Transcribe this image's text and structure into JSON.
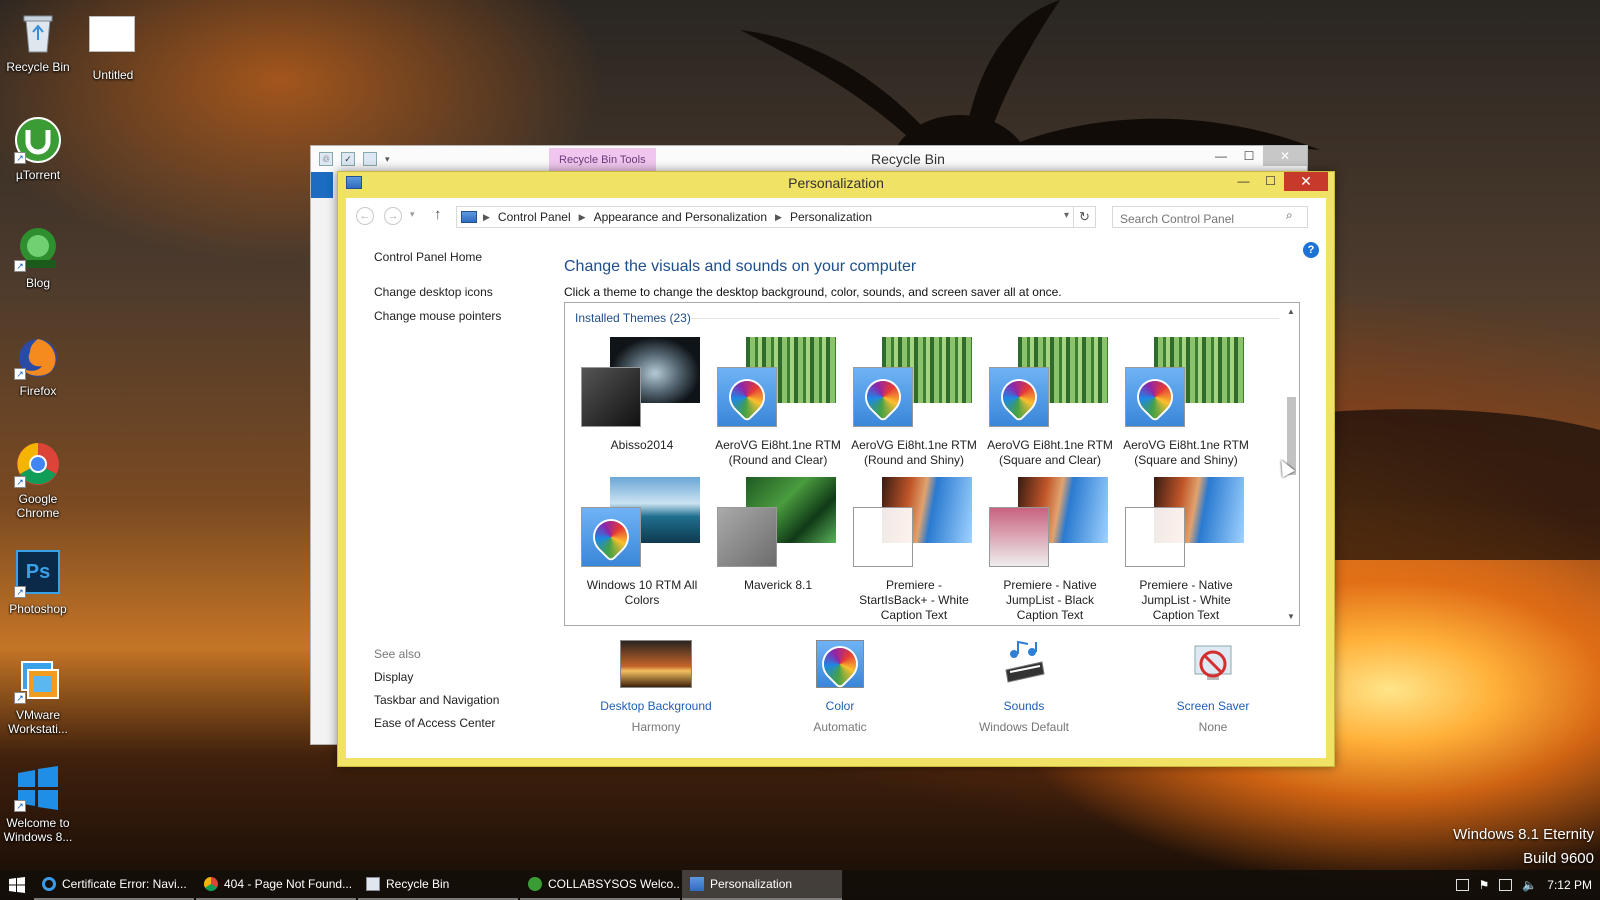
{
  "desktop": {
    "icons": [
      {
        "label": "Recycle Bin",
        "icon": "recycle-bin-icon"
      },
      {
        "label": "Untitled",
        "icon": "blank-file-icon"
      },
      {
        "label": "µTorrent",
        "icon": "utorrent-icon"
      },
      {
        "label": "Blog",
        "icon": "collabsysos-icon"
      },
      {
        "label": "Firefox",
        "icon": "firefox-icon"
      },
      {
        "label": "Google Chrome",
        "icon": "chrome-icon"
      },
      {
        "label": "Photoshop",
        "icon": "photoshop-icon"
      },
      {
        "label": "VMware Workstati...",
        "icon": "vmware-icon"
      },
      {
        "label": "Welcome to Windows 8...",
        "icon": "windows-icon"
      }
    ],
    "photoshop_badge": "Ps",
    "watermark": {
      "line1": "Windows 8.1 Eternity",
      "line2": "Build 9600"
    }
  },
  "recycle_window": {
    "tools_tab": "Recycle Bin Tools",
    "title": "Recycle Bin"
  },
  "window": {
    "title": "Personalization",
    "controls": {
      "minimize": "—",
      "maximize": "☐",
      "close": "✕"
    }
  },
  "address": {
    "crumbs": [
      "Control Panel",
      "Appearance and Personalization",
      "Personalization"
    ],
    "search_placeholder": "Search Control Panel"
  },
  "left_pane": {
    "links": [
      "Control Panel Home",
      "Change desktop icons",
      "Change mouse pointers"
    ],
    "see_also_header": "See also",
    "see_also": [
      "Display",
      "Taskbar and Navigation",
      "Ease of Access Center"
    ]
  },
  "main": {
    "heading": "Change the visuals and sounds on your computer",
    "description": "Click a theme to change the desktop background, color, sounds, and screen saver all at once.",
    "category": "Installed Themes (23)",
    "themes": [
      {
        "line1": "Abisso2014",
        "line2": "",
        "line3": ""
      },
      {
        "line1": "AeroVG Ei8ht.1ne RTM",
        "line2": "(Round and Clear)",
        "line3": ""
      },
      {
        "line1": "AeroVG Ei8ht.1ne RTM",
        "line2": "(Round and Shiny)",
        "line3": ""
      },
      {
        "line1": "AeroVG Ei8ht.1ne RTM",
        "line2": "(Square and Clear)",
        "line3": ""
      },
      {
        "line1": "AeroVG Ei8ht.1ne RTM",
        "line2": "(Square and Shiny)",
        "line3": ""
      },
      {
        "line1": "Windows 10 RTM All",
        "line2": "Colors",
        "line3": ""
      },
      {
        "line1": "Maverick 8.1",
        "line2": "",
        "line3": ""
      },
      {
        "line1": "Premiere -",
        "line2": "StartIsBack+ - White",
        "line3": "Caption Text"
      },
      {
        "line1": "Premiere - Native",
        "line2": "JumpList - Black",
        "line3": "Caption Text"
      },
      {
        "line1": "Premiere - Native",
        "line2": "JumpList - White",
        "line3": "Caption Text"
      }
    ]
  },
  "settings": [
    {
      "name": "Desktop Background",
      "value": "Harmony"
    },
    {
      "name": "Color",
      "value": "Automatic"
    },
    {
      "name": "Sounds",
      "value": "Windows Default"
    },
    {
      "name": "Screen Saver",
      "value": "None"
    }
  ],
  "taskbar": {
    "items": [
      {
        "label": "Certificate Error: Navi...",
        "icon": "ie-icon"
      },
      {
        "label": "404 - Page Not Found...",
        "icon": "chrome-icon"
      },
      {
        "label": "Recycle Bin",
        "icon": "recycle-bin-icon"
      },
      {
        "label": "COLLABSYSOS Welco...",
        "icon": "collabsysos-icon"
      },
      {
        "label": "Personalization",
        "icon": "control-panel-icon"
      }
    ],
    "clock": "7:12 PM"
  }
}
